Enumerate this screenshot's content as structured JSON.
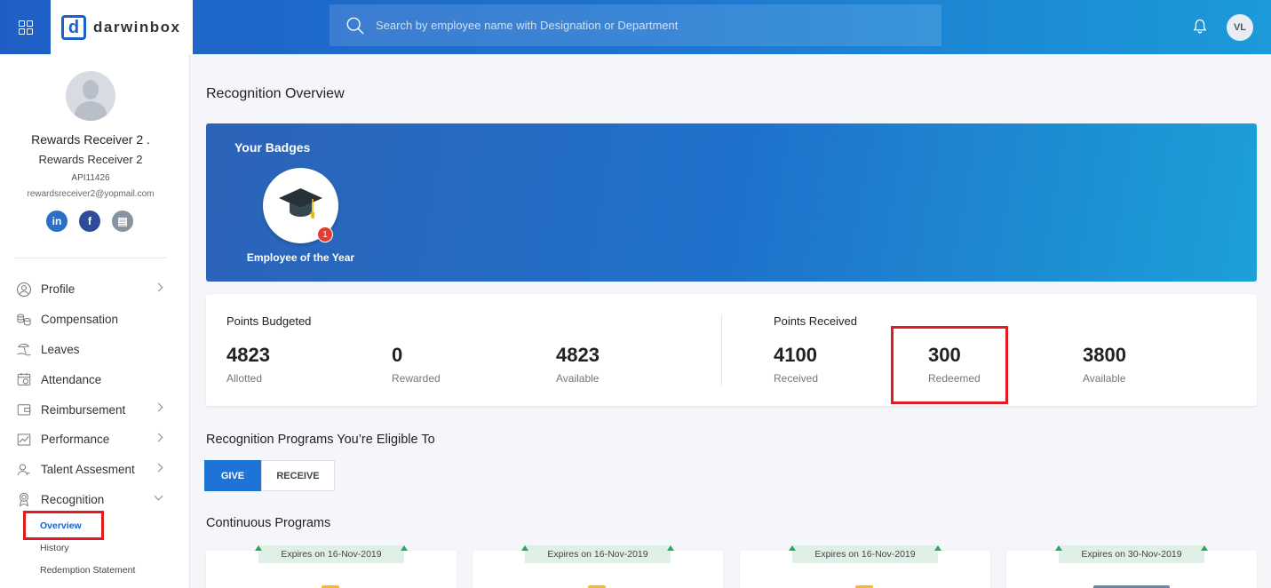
{
  "topbar": {
    "logo_mark": "d",
    "logo_text": "darwinbox",
    "search_placeholder": "Search by employee name with Designation or Department",
    "avatar_initials": "VL"
  },
  "profile": {
    "name": "Rewards Receiver 2 .",
    "subtitle": "Rewards Receiver 2",
    "employee_id": "API11426",
    "email": "rewardsreceiver2@yopmail.com",
    "socials": [
      "in",
      "f",
      "▤"
    ]
  },
  "nav": {
    "items": [
      {
        "label": "Profile",
        "icon": "user-circle-icon",
        "has_chevron": true
      },
      {
        "label": "Compensation",
        "icon": "coins-icon",
        "has_chevron": false
      },
      {
        "label": "Leaves",
        "icon": "beach-icon",
        "has_chevron": false
      },
      {
        "label": "Attendance",
        "icon": "calendar-check-icon",
        "has_chevron": false
      },
      {
        "label": "Reimbursement",
        "icon": "wallet-icon",
        "has_chevron": true
      },
      {
        "label": "Performance",
        "icon": "chart-line-icon",
        "has_chevron": true
      },
      {
        "label": "Talent Assesment",
        "icon": "person-icon",
        "has_chevron": true
      },
      {
        "label": "Recognition",
        "icon": "award-icon",
        "has_chevron": true
      }
    ],
    "sub_items": [
      "Overview",
      "History",
      "Redemption Statement"
    ]
  },
  "main": {
    "title": "Recognition Overview",
    "badges": {
      "title": "Your Badges",
      "items": [
        {
          "name": "Employee of the Year",
          "count": "1",
          "icon": "graduation-cap-icon"
        }
      ]
    },
    "points": {
      "budgeted_title": "Points Budgeted",
      "budgeted": [
        {
          "value": "4823",
          "label": "Allotted"
        },
        {
          "value": "0",
          "label": "Rewarded"
        },
        {
          "value": "4823",
          "label": "Available"
        }
      ],
      "received_title": "Points Received",
      "received": [
        {
          "value": "4100",
          "label": "Received"
        },
        {
          "value": "300",
          "label": "Redeemed"
        },
        {
          "value": "3800",
          "label": "Available"
        }
      ]
    },
    "programs_title": "Recognition Programs You’re Eligible To",
    "toggle": {
      "give": "GIVE",
      "receive": "RECEIVE"
    },
    "continuous_title": "Continuous Programs",
    "program_cards": [
      {
        "expires": "Expires on 16-Nov-2019"
      },
      {
        "expires": "Expires on 16-Nov-2019"
      },
      {
        "expires": "Expires on 16-Nov-2019"
      },
      {
        "expires": "Expires on 30-Nov-2019"
      }
    ]
  },
  "colors": {
    "accent": "#1e73d6",
    "highlight_red": "#e11b22",
    "badge_count": "#e63b2e"
  }
}
